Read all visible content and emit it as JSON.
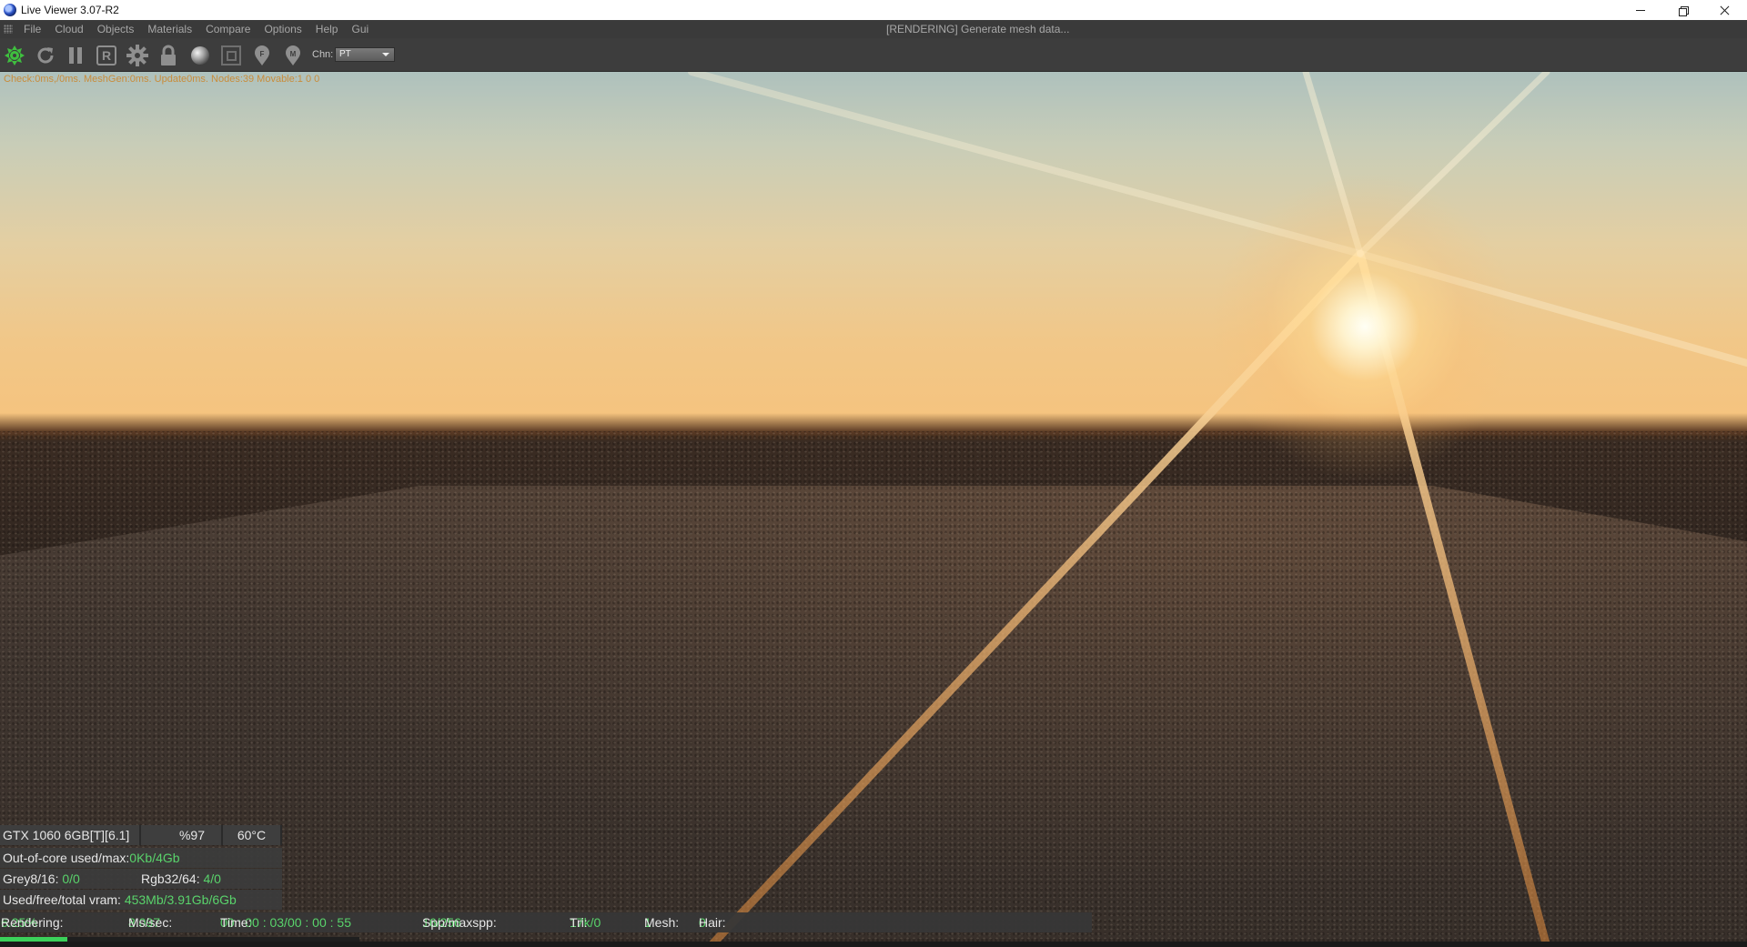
{
  "window": {
    "title": "Live Viewer 3.07-R2"
  },
  "menu": {
    "items": [
      "File",
      "Cloud",
      "Objects",
      "Materials",
      "Compare",
      "Options",
      "Help",
      "Gui"
    ],
    "status_title": "[RENDERING] Generate mesh data..."
  },
  "toolbar": {
    "buttons": [
      "restart-icon",
      "refresh-icon",
      "pause-icon",
      "region-icon",
      "settings-icon",
      "lock-icon",
      "material-ball-icon",
      "clay-mode-icon",
      "pick-focus-icon",
      "pick-material-icon"
    ],
    "channel_label": "Chn:",
    "channel_value": "PT"
  },
  "viewport": {
    "info_line": "Check:0ms,/0ms. MeshGen:0ms. Update0ms. Nodes:39 Movable:1   0 0"
  },
  "hud": {
    "gpu_name": "GTX 1060 6GB[T][6.1]",
    "gpu_usage": "%97",
    "gpu_temp": "60°C",
    "out_of_core_label": "Out-of-core used/max:",
    "out_of_core_value": "0Kb/4Gb",
    "grey_label": "Grey8/16: ",
    "grey_value": "0/0",
    "rgb_label": "Rgb32/64: ",
    "rgb_value": "4/0",
    "vram_label": "Used/free/total vram: ",
    "vram_value": "453Mb/3.91Gb/6Gb"
  },
  "status": {
    "rendering_label": "Rendering: ",
    "rendering_value": "6.25%",
    "mssec_label": "Ms/sec: ",
    "mssec_value": "8.097",
    "time_label": "Time: ",
    "time_value": "00 : 00 : 03/00 : 00 : 55",
    "spp_label": "Spp/maxspp: ",
    "spp_value": "16/256",
    "tri_label": "Tri: ",
    "tri_value": "17k/0",
    "mesh_label": "Mesh: ",
    "mesh_value": "1",
    "hair_label": "Hair: ",
    "hair_value": "0",
    "progress": 0.0625
  },
  "colors": {
    "accent_green": "#59d36b",
    "info_orange": "#c98c3a"
  }
}
